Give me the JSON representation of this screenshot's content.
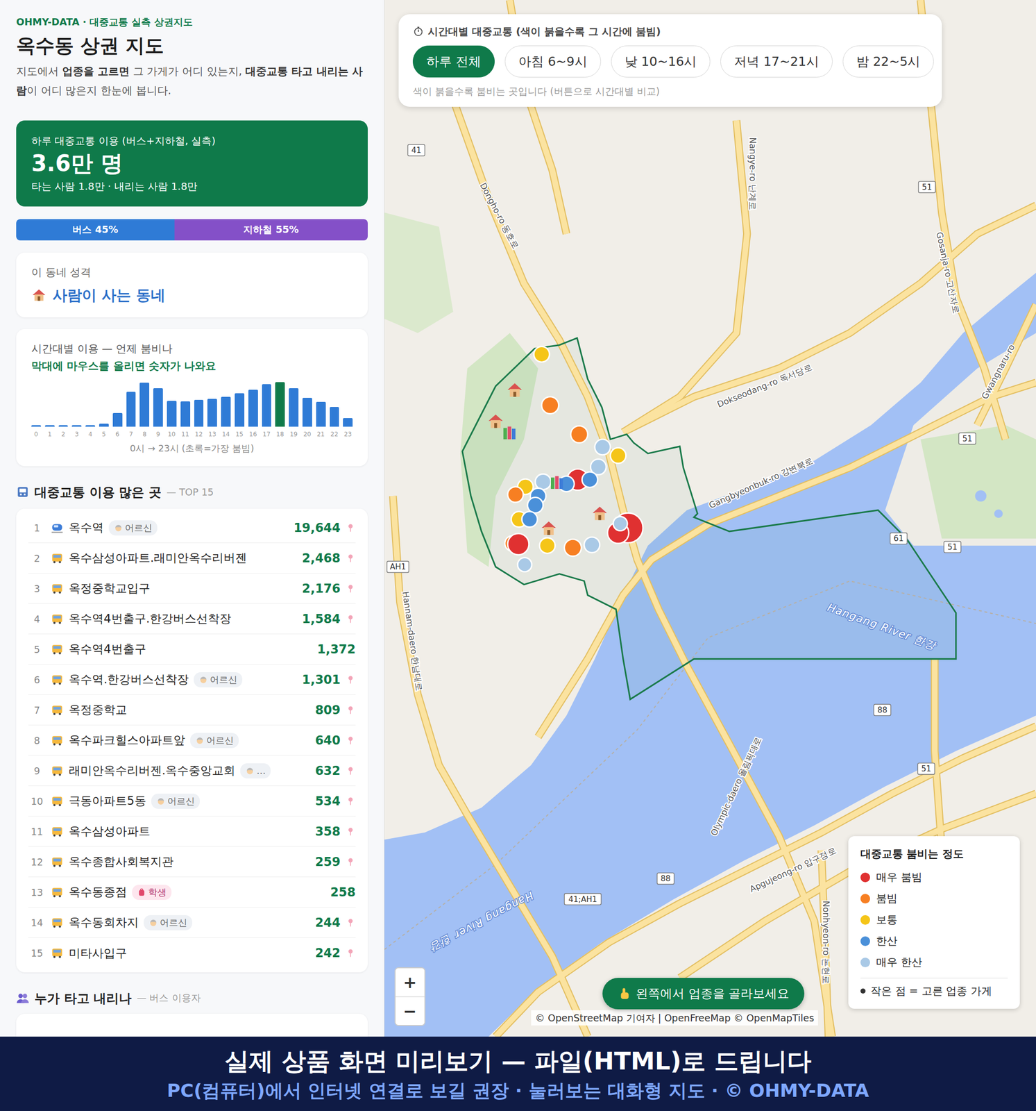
{
  "header": {
    "brand": "OHMY-DATA · 대중교통 실측 상권지도",
    "title": "옥수동 상권 지도",
    "description": [
      {
        "text": "지도에서 ",
        "bold": false
      },
      {
        "text": "업종을 고르면",
        "bold": true
      },
      {
        "text": " 그 가게가 어디 있는지, ",
        "bold": false
      },
      {
        "text": "대중교통 타고 내리는 사람",
        "bold": true
      },
      {
        "text": "이 어디 많은지 한눈에 봅니다.",
        "bold": false
      }
    ]
  },
  "summary": {
    "label": "하루 대중교통 이용 (버스+지하철, 실측)",
    "value": "3.6만 명",
    "detail": "타는 사람 1.8만 · 내리는 사람 1.8만"
  },
  "mode_split": [
    {
      "label": "버스 45%",
      "level": 0.45,
      "color": "#2f7bd6"
    },
    {
      "label": "지하철 55%",
      "level": 0.55,
      "color": "#8450c8"
    }
  ],
  "character": {
    "label": "이 동네 성격",
    "value": "사람이 사는 동네"
  },
  "hourly_chart": {
    "title": "시간대별 이용 — 언제 붐비나",
    "hint": "막대에 마우스를 올리면 숫자가 나와요",
    "values": [
      40,
      30,
      25,
      25,
      30,
      110,
      520,
      1350,
      1700,
      1480,
      1000,
      980,
      1030,
      1080,
      1150,
      1300,
      1420,
      1640,
      1720,
      1480,
      1120,
      950,
      760,
      330
    ],
    "ticks": [
      "0",
      "1",
      "2",
      "3",
      "4",
      "5",
      "6",
      "7",
      "8",
      "9",
      "10",
      "11",
      "12",
      "13",
      "14",
      "15",
      "16",
      "17",
      "18",
      "19",
      "20",
      "21",
      "22",
      "23"
    ],
    "caption": "0시 → 23시 (초록=가장 붐빔)"
  },
  "top_stops": {
    "title": "대중교통 이용 많은 곳",
    "subtitle": "— TOP 15",
    "rows": [
      {
        "rank": "1",
        "kind": "subway",
        "name": "옥수역",
        "badge": {
          "text": "어르신",
          "kind": "elder"
        },
        "count": "19,644",
        "pin": true
      },
      {
        "rank": "2",
        "kind": "bus",
        "name": "옥수삼성아파트.래미안옥수리버젠",
        "count": "2,468",
        "pin": true
      },
      {
        "rank": "3",
        "kind": "bus",
        "name": "옥정중학교입구",
        "count": "2,176",
        "pin": true
      },
      {
        "rank": "4",
        "kind": "bus",
        "name": "옥수역4번출구.한강버스선착장",
        "count": "1,584",
        "pin": true
      },
      {
        "rank": "5",
        "kind": "bus",
        "name": "옥수역4번출구",
        "count": "1,372",
        "pin": false
      },
      {
        "rank": "6",
        "kind": "bus",
        "name": "옥수역.한강버스선착장",
        "badge": {
          "text": "어르신",
          "kind": "elder"
        },
        "count": "1,301",
        "pin": true
      },
      {
        "rank": "7",
        "kind": "bus",
        "name": "옥정중학교",
        "count": "809",
        "pin": true
      },
      {
        "rank": "8",
        "kind": "bus",
        "name": "옥수파크힐스아파트앞",
        "badge": {
          "text": "어르신",
          "kind": "elder"
        },
        "count": "640",
        "pin": true
      },
      {
        "rank": "9",
        "kind": "bus",
        "name": "래미안옥수리버젠.옥수중앙교회",
        "badge": {
          "text": "…",
          "kind": "elder"
        },
        "count": "632",
        "pin": true
      },
      {
        "rank": "10",
        "kind": "bus",
        "name": "극동아파트5동",
        "badge": {
          "text": "어르신",
          "kind": "elder"
        },
        "count": "534",
        "pin": true
      },
      {
        "rank": "11",
        "kind": "bus",
        "name": "옥수삼성아파트",
        "count": "358",
        "pin": true
      },
      {
        "rank": "12",
        "kind": "bus",
        "name": "옥수종합사회복지관",
        "count": "259",
        "pin": true
      },
      {
        "rank": "13",
        "kind": "bus",
        "name": "옥수동종점",
        "badge": {
          "text": "학생",
          "kind": "student"
        },
        "count": "258",
        "pin": false
      },
      {
        "rank": "14",
        "kind": "bus",
        "name": "옥수동회차지",
        "badge": {
          "text": "어르신",
          "kind": "elder"
        },
        "count": "244",
        "pin": true
      },
      {
        "rank": "15",
        "kind": "bus",
        "name": "미타사입구",
        "count": "242",
        "pin": true
      }
    ]
  },
  "riders_section": {
    "title": "누가 타고 내리나",
    "subtitle": "— 버스 이용자"
  },
  "time_filter": {
    "title": "시간대별 대중교통 (색이 붉을수록 그 시간에 붐빔)",
    "buttons": [
      {
        "label": "하루 전체",
        "selected": true
      },
      {
        "label": "아침 6~9시",
        "selected": false
      },
      {
        "label": "낮 10~16시",
        "selected": false
      },
      {
        "label": "저녁 17~21시",
        "selected": false
      },
      {
        "label": "밤 22~5시",
        "selected": false
      }
    ],
    "hint": "색이 붉을수록 붐비는 곳입니다 (버튼으로 시간대별 비교)"
  },
  "map": {
    "labels": [
      "Dongho-ro 동호로",
      "Nangye-ro 난계로",
      "Dokseodang-ro 독서당로",
      "Gangbyeonbuk-ro 강변북로",
      "Gosanja-ro 고산자로",
      "Gwangnaru-ro",
      "Hangang River 한강",
      "Hangang River 한강",
      "Hannam-daero 한남대로",
      "Olympic-daero 올림픽대로",
      "Apgujeong-ro 압구정로",
      "Nonhyeon-ro 논현로"
    ],
    "shields": [
      "41",
      "51",
      "51",
      "61",
      "51",
      "88",
      "51",
      "88",
      "41;AH1",
      "AH1"
    ],
    "markers": [
      {
        "color": "#f5c518"
      },
      {
        "color": "#f77f22"
      },
      {
        "color": "#f77f22"
      },
      {
        "color": "#a9c9e6"
      },
      {
        "color": "#f5c518"
      },
      {
        "color": "#a9c9e6"
      },
      {
        "color": "#e03131"
      },
      {
        "color": "#4a90d9"
      },
      {
        "color": "#4a90d9"
      },
      {
        "color": "#a9c9e6"
      },
      {
        "color": "#f5c518"
      },
      {
        "color": "#f77f22"
      },
      {
        "color": "#4a90d9"
      },
      {
        "color": "#4a90d9"
      },
      {
        "color": "#f5c518"
      },
      {
        "color": "#4a90d9"
      },
      {
        "color": "#f77f22"
      },
      {
        "color": "#e03131"
      },
      {
        "color": "#f5c518"
      },
      {
        "color": "#f77f22"
      },
      {
        "color": "#a9c9e6"
      },
      {
        "color": "#a9c9e6"
      },
      {
        "color": "#e03131"
      },
      {
        "color": "#e03131"
      },
      {
        "color": "#a9c9e6"
      }
    ],
    "zoom": [
      "+",
      "−"
    ],
    "cta": "왼쪽에서 업종을 골라보세요",
    "attribution": "© OpenStreetMap 기여자 | OpenFreeMap © OpenMapTiles"
  },
  "legend": {
    "title": "대중교통 붐비는 정도",
    "items": [
      {
        "label": "매우 붐빔",
        "color": "#e03131"
      },
      {
        "label": "붐빔",
        "color": "#f77f22"
      },
      {
        "label": "보통",
        "color": "#f5c518"
      },
      {
        "label": "한산",
        "color": "#4a90d9"
      },
      {
        "label": "매우 한산",
        "color": "#a9c9e6"
      }
    ],
    "note": "작은 점 = 고른 업종 가게"
  },
  "banner": {
    "line1": "실제 상품 화면 미리보기 — 파일(HTML)로 드립니다",
    "line2": "PC(컴퓨터)에서 인터넷 연결로 보길 권장 · 눌러보는 대화형 지도 · © OHMY-DATA"
  }
}
